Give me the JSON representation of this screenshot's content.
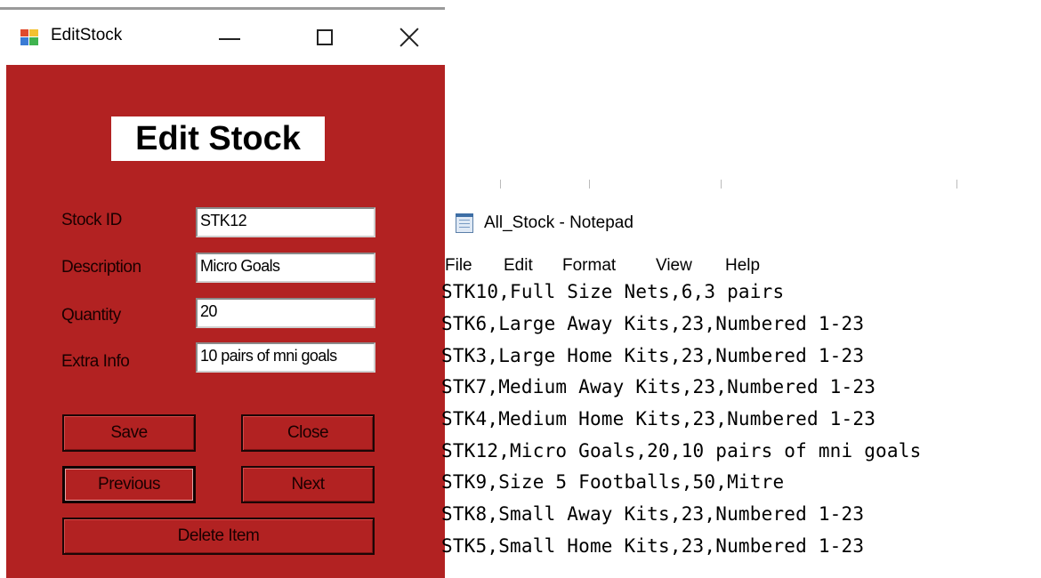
{
  "editstock": {
    "window_title": "EditStock",
    "heading": "Edit Stock",
    "labels": {
      "stock_id": "Stock ID",
      "description": "Description",
      "quantity": "Quantity",
      "extra_info": "Extra Info"
    },
    "fields": {
      "stock_id": "STK12",
      "description": "Micro Goals",
      "quantity": "20",
      "extra_info": "10 pairs of mni goals"
    },
    "buttons": {
      "save": "Save",
      "close": "Close",
      "previous": "Previous",
      "next": "Next",
      "delete": "Delete Item"
    },
    "colors": {
      "form_background": "#b22222"
    }
  },
  "notepad": {
    "window_title": "All_Stock - Notepad",
    "menu": [
      "File",
      "Edit",
      "Format",
      "View",
      "Help"
    ],
    "lines": [
      "STK10,Full Size Nets,6,3 pairs",
      "STK6,Large Away Kits,23,Numbered 1-23",
      "STK3,Large Home Kits,23,Numbered 1-23",
      "STK7,Medium Away Kits,23,Numbered 1-23",
      "STK4,Medium Home Kits,23,Numbered 1-23",
      "STK12,Micro Goals,20,10 pairs of mni goals",
      "STK9,Size 5 Footballs,50,Mitre",
      "STK8,Small Away Kits,23,Numbered 1-23",
      "STK5,Small Home Kits,23,Numbered 1-23"
    ]
  }
}
